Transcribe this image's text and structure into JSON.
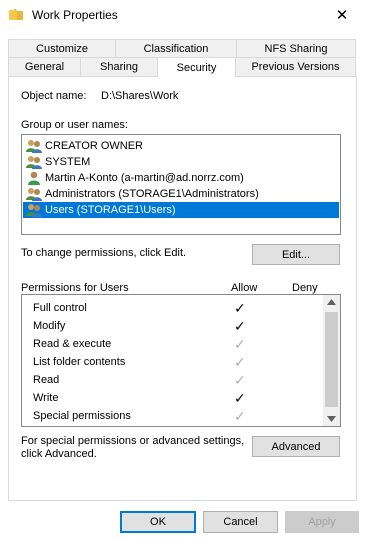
{
  "window": {
    "title": "Work Properties"
  },
  "tabs_back": [
    "Customize",
    "Classification",
    "NFS Sharing"
  ],
  "tabs_front": [
    "General",
    "Sharing",
    "Security",
    "Previous Versions"
  ],
  "object": {
    "label": "Object name:",
    "value": "D:\\Shares\\Work"
  },
  "groups": {
    "label": "Group or user names:",
    "items": [
      {
        "name": "CREATOR OWNER",
        "icon": "group-icon"
      },
      {
        "name": "SYSTEM",
        "icon": "group-icon"
      },
      {
        "name": "Martin A-Konto (a-martin@ad.norrz.com)",
        "icon": "user-icon"
      },
      {
        "name": "Administrators (STORAGE1\\Administrators)",
        "icon": "group-icon"
      },
      {
        "name": "Users (STORAGE1\\Users)",
        "icon": "group-icon",
        "selected": true
      }
    ]
  },
  "change_text": "To change permissions, click Edit.",
  "edit_label": "Edit...",
  "permissions": {
    "header": "Permissions for Users",
    "allow": "Allow",
    "deny": "Deny",
    "rows": [
      {
        "name": "Full control",
        "allow": "enabled"
      },
      {
        "name": "Modify",
        "allow": "enabled"
      },
      {
        "name": "Read & execute",
        "allow": "disabled"
      },
      {
        "name": "List folder contents",
        "allow": "disabled"
      },
      {
        "name": "Read",
        "allow": "disabled"
      },
      {
        "name": "Write",
        "allow": "enabled"
      },
      {
        "name": "Special permissions",
        "allow": "disabled"
      }
    ]
  },
  "special_text_1": "For special permissions or advanced settings,",
  "special_text_2": "click Advanced.",
  "advanced_label": "Advanced",
  "buttons": {
    "ok": "OK",
    "cancel": "Cancel",
    "apply": "Apply"
  },
  "check_glyph": "✓",
  "colors": {
    "selection": "#0078d7",
    "check_enabled": "#000000",
    "check_disabled": "#b0b0b0"
  }
}
